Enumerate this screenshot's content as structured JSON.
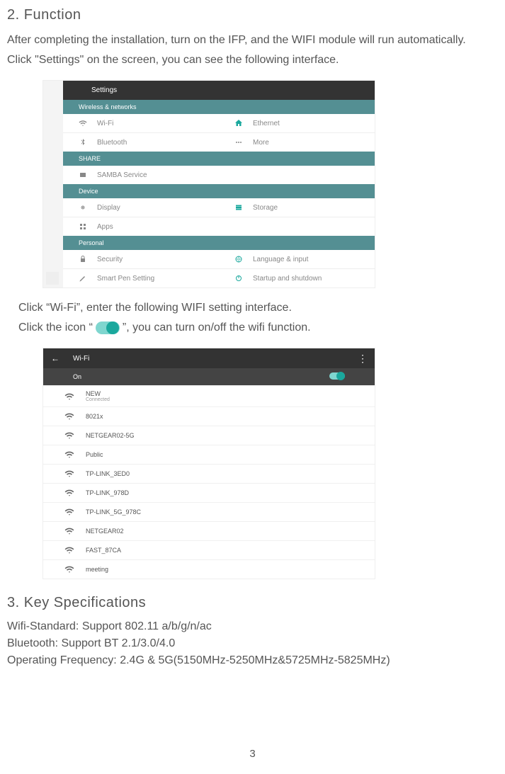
{
  "section2": {
    "heading": "2. Function",
    "para1": "After completing the installation, turn on the IFP, and the WIFI module will run automatically.",
    "para2": "Click \"Settings\" on the screen, you can see the following interface.",
    "after_shot1_line1": "Click “Wi-Fi”,  enter the following WIFI setting interface.",
    "after_shot1_line2a": "Click the icon “ ",
    "after_shot1_line2b": " ”, you can turn on/off the wifi function."
  },
  "settings_screenshot": {
    "title": "Settings",
    "wireless_hdr": "Wireless & networks",
    "wifi": "Wi-Fi",
    "ethernet": "Ethernet",
    "bluetooth": "Bluetooth",
    "more": "More",
    "share_hdr": "SHARE",
    "samba": "SAMBA Service",
    "device_hdr": "Device",
    "display": "Display",
    "storage": "Storage",
    "apps": "Apps",
    "personal_hdr": "Personal",
    "security": "Security",
    "lang": "Language & input",
    "pen": "Smart Pen Setting",
    "startup": "Startup and shutdown"
  },
  "wifi_screenshot": {
    "title": "Wi-Fi",
    "on_label": "On",
    "networks": [
      {
        "name": "NEW",
        "sub": "Connected"
      },
      {
        "name": "8021x",
        "sub": ""
      },
      {
        "name": "NETGEAR02-5G",
        "sub": ""
      },
      {
        "name": "Public",
        "sub": ""
      },
      {
        "name": "TP-LINK_3ED0",
        "sub": ""
      },
      {
        "name": "TP-LINK_978D",
        "sub": ""
      },
      {
        "name": "TP-LINK_5G_978C",
        "sub": ""
      },
      {
        "name": "NETGEAR02",
        "sub": ""
      },
      {
        "name": "FAST_87CA",
        "sub": ""
      },
      {
        "name": "meeting",
        "sub": ""
      }
    ]
  },
  "section3": {
    "heading": "3. Key Specifications",
    "wifi_std_label": "Wifi-Standard:",
    "wifi_std_val": "  Support 802.11 a/b/g/n/ac",
    "bt_label": "Bluetooth:",
    "bt_val": "  Support BT 2.1/3.0/4.0",
    "freq_label": "Operating Frequency:",
    "freq_val": "  2.4G & 5G(5150MHz-5250MHz&5725MHz-5825MHz)"
  },
  "page_number": "3"
}
